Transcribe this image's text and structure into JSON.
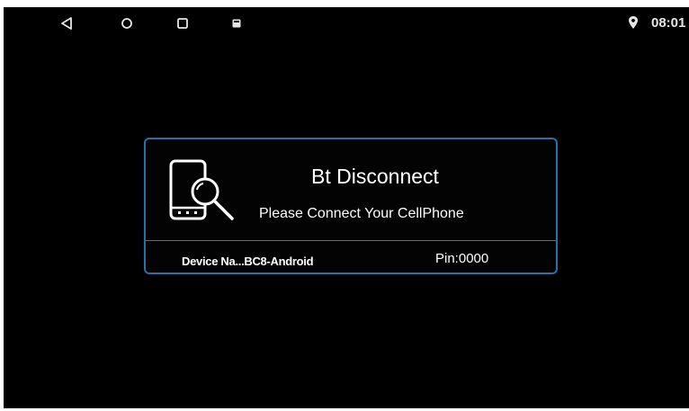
{
  "status_bar": {
    "nav_icons": [
      "back-icon",
      "home-icon",
      "recent-apps-icon",
      "screenshot-icon"
    ],
    "location_icon": "location-pin-icon",
    "time": "08:01"
  },
  "dialog": {
    "icon": "phone-search-icon",
    "title": "Bt Disconnect",
    "message": "Please Connect Your CellPhone",
    "device_name": "Device Na...BC8-Android",
    "pin": "Pin:0000",
    "border_color": "#2b6fa8"
  },
  "colors": {
    "background": "#000000",
    "text": "#ffffff",
    "status_icons": "#e6e6e6"
  }
}
